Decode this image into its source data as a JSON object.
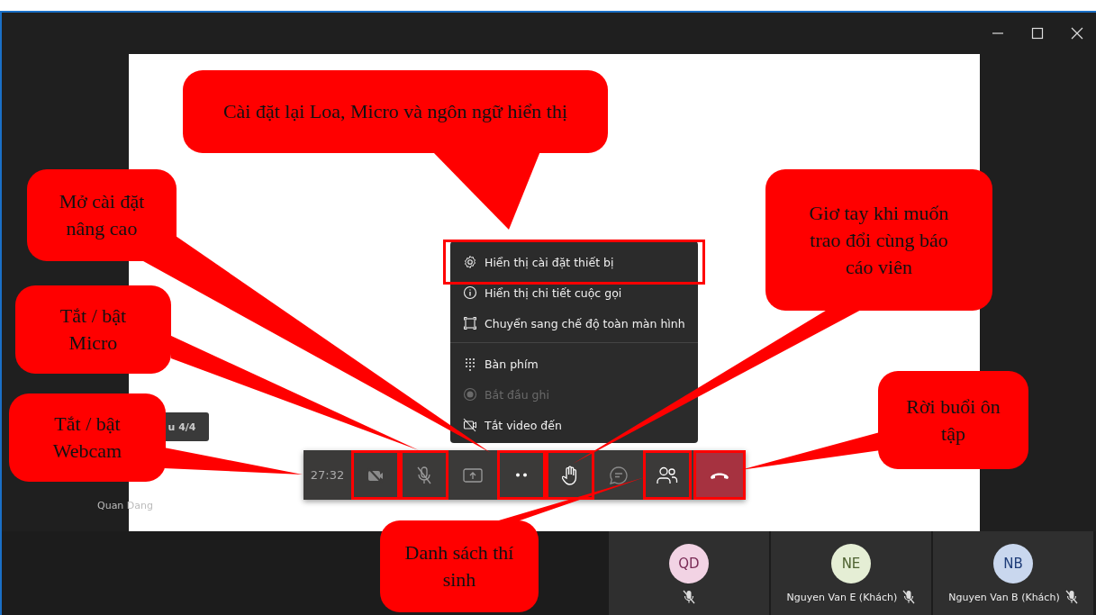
{
  "slide": {
    "label": "u 4/4",
    "presenter": "Quan Dang"
  },
  "menu": {
    "sections": [
      [
        {
          "kind": "settings",
          "label": "Hiển thị cài đặt thiết bị",
          "disabled": false,
          "highlighted": true
        },
        {
          "kind": "info",
          "label": "Hiển thị chi tiết cuộc gọi",
          "disabled": false,
          "highlighted": false
        },
        {
          "kind": "fullscreen",
          "label": "Chuyển sang chế độ toàn màn hình",
          "disabled": false,
          "highlighted": false
        }
      ],
      [
        {
          "kind": "keypad",
          "label": "Bàn phím",
          "disabled": false,
          "highlighted": false
        },
        {
          "kind": "record",
          "label": "Bắt đầu ghi",
          "disabled": true,
          "highlighted": false
        },
        {
          "kind": "video-off",
          "label": "Tắt video đến",
          "disabled": false,
          "highlighted": false
        }
      ]
    ]
  },
  "toolbar": {
    "timer": "27:32",
    "buttons": [
      {
        "kind": "camera",
        "highlighted": true
      },
      {
        "kind": "mic",
        "highlighted": true
      },
      {
        "kind": "share",
        "highlighted": false
      },
      {
        "kind": "more",
        "highlighted": true
      },
      {
        "kind": "hand",
        "highlighted": true
      },
      {
        "kind": "chat",
        "highlighted": false
      },
      {
        "kind": "people",
        "highlighted": true
      },
      {
        "kind": "hangup",
        "highlighted": true
      }
    ]
  },
  "participants": [
    {
      "initials": "QD",
      "color": "#f2d3e4"
    },
    {
      "initials": "NE",
      "name": "Nguyen Van E (Khách)",
      "color": "#e5eed5"
    },
    {
      "initials": "NB",
      "name": "Nguyen Van B (Khách)",
      "color": "#c9d7ee"
    }
  ],
  "callouts": [
    {
      "text": "Cài đặt lại Loa, Micro và ngôn ngữ hiển thị"
    },
    {
      "text": "Mở cài đặt nâng cao"
    },
    {
      "text": "Tắt / bật Micro"
    },
    {
      "text": "Tắt / bật Webcam"
    },
    {
      "text": "Giơ tay khi muốn trao đổi cùng báo cáo viên"
    },
    {
      "text": "Rời buổi ôn tập"
    },
    {
      "text": "Danh sách thí sinh"
    }
  ]
}
